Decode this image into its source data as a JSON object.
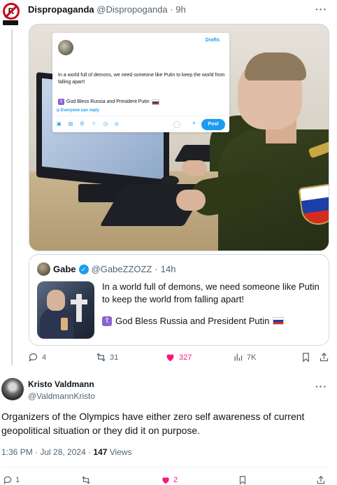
{
  "thread_tweet": {
    "author_name": "Dispropaganda",
    "author_handle": "@Dispropoganda",
    "dot": "·",
    "time": "9h",
    "more": "···",
    "avatar_logo_text": "R",
    "media": {
      "draft_overlay": {
        "drafts_label": "Drafts",
        "text": "In a world full of demons, we need someone like Putin to keep the world from falling apart!",
        "bless_text": "God Bless Russia and President Putin",
        "reply_setting": "Everyone can reply",
        "post_button": "Post",
        "plus": "+"
      }
    },
    "quoted": {
      "author_name": "Gabe",
      "author_handle": "@GabeZZOZZ",
      "dot": "·",
      "time": "14h",
      "text": "In a world full of demons, we need someone like Putin to keep the world from falling apart!",
      "bless_text": "God Bless Russia and President Putin",
      "verified_mark": "✓",
      "orthodox_mark": "☦"
    },
    "stats": {
      "replies": "4",
      "reposts": "31",
      "likes": "327",
      "views": "7K"
    }
  },
  "main_tweet": {
    "author_name": "Kristo Valdmann",
    "author_handle": "@ValdmannKristo",
    "more": "···",
    "text": "Organizers of the Olympics have either zero self awareness of current geopolitical situation or they did it on purpose.",
    "time": "1:36 PM · Jul 28, 2024 · ",
    "views_count": "147",
    "views_label": " Views",
    "stats": {
      "replies": "1",
      "likes": "2"
    }
  },
  "colors": {
    "accent": "#1d9bf0",
    "like": "#f91880",
    "muted": "#536471",
    "border": "#cfd9de"
  },
  "icons": [
    "reply-icon",
    "repost-icon",
    "like-icon",
    "views-icon",
    "bookmark-icon",
    "share-icon",
    "verified-icon",
    "orthodox-cross-icon",
    "russia-flag-icon"
  ]
}
